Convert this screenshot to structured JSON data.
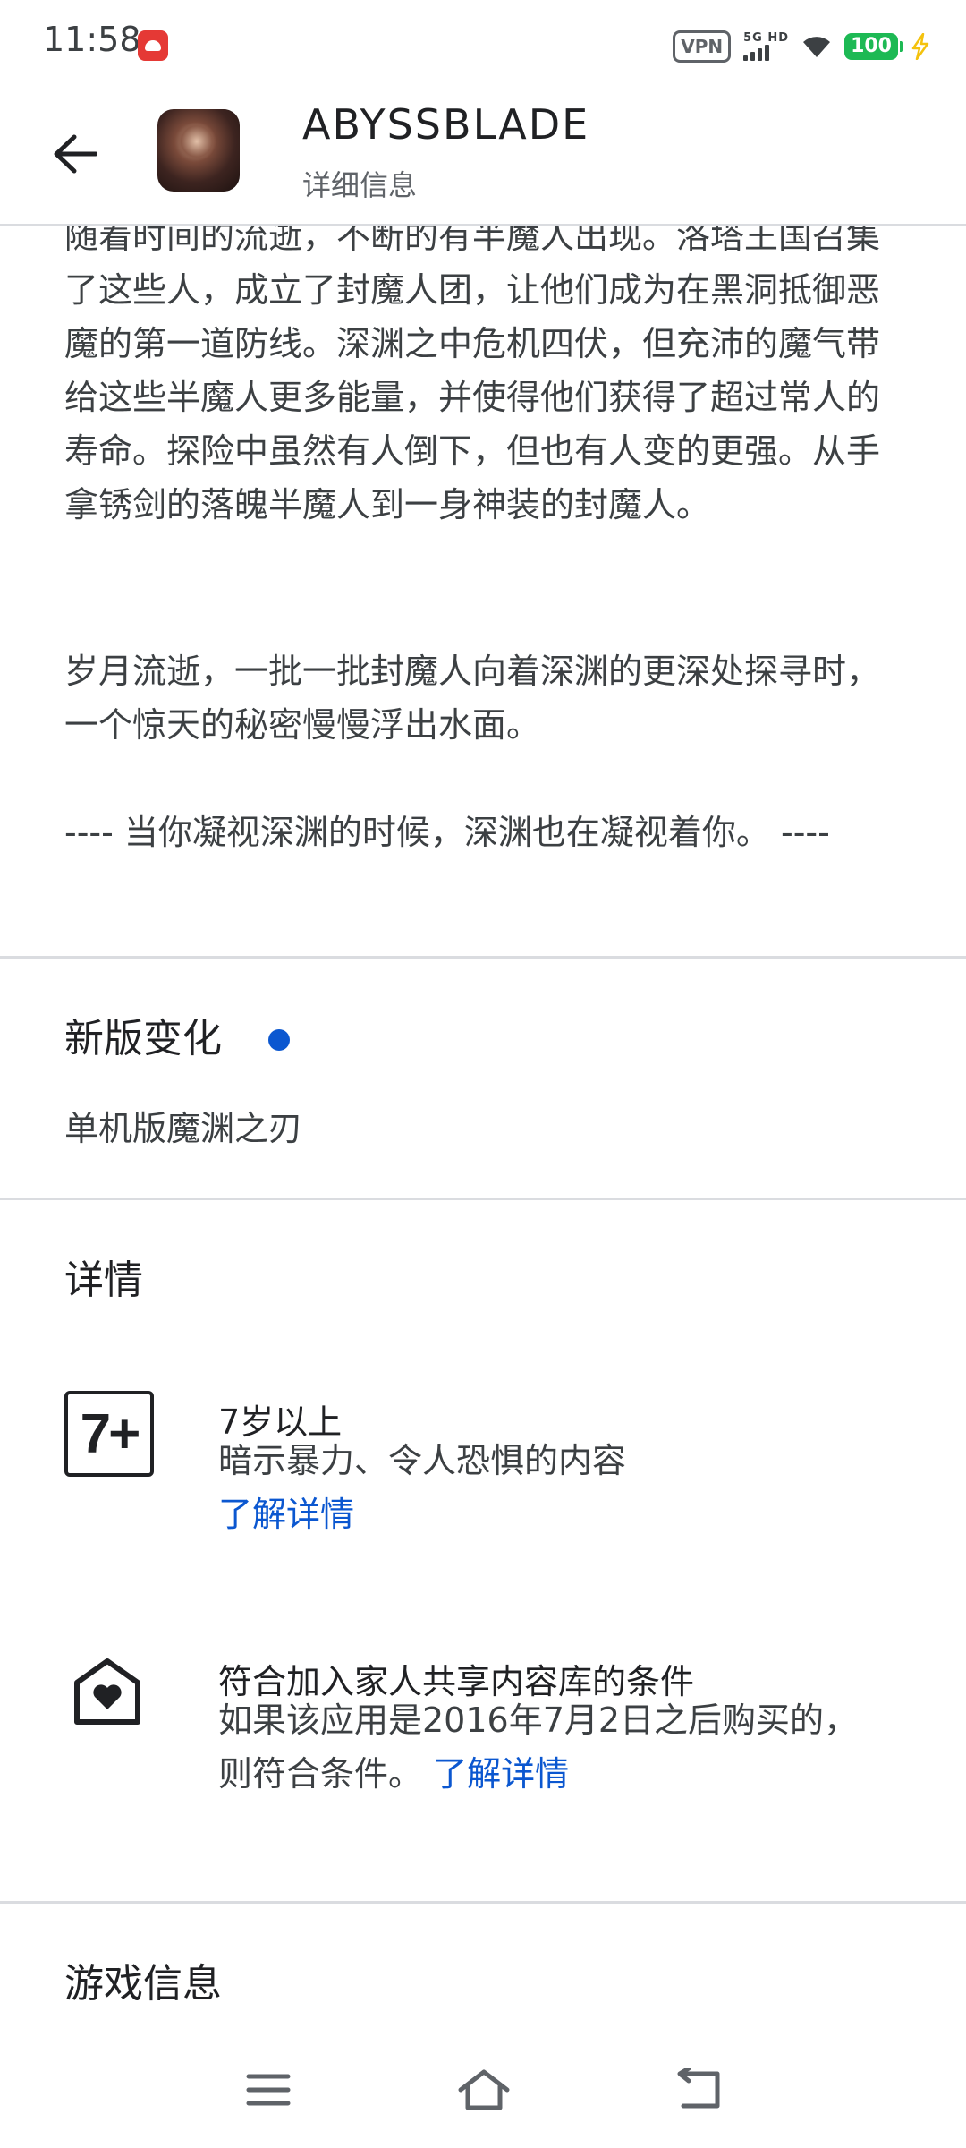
{
  "status_bar": {
    "time": "11:58",
    "vpn": "VPN",
    "network": "5G HD",
    "battery": "100"
  },
  "header": {
    "app_name": "ABYSSBLADE",
    "subtitle": "详细信息"
  },
  "description": {
    "paragraph_1": "随着时间的流逝，不断的有半魔人出现。洛塔王国召集了这些人，成立了封魔人团，让他们成为在黑洞抵御恶魔的第一道防线。深渊之中危机四伏，但充沛的魔气带给这些半魔人更多能量，并使得他们获得了超过常人的寿命。探险中虽然有人倒下，但也有人变的更强。从手拿锈剑的落魄半魔人到一身神装的封魔人。",
    "paragraph_2": "岁月流逝，一批一批封魔人向着深渊的更深处探寻时，一个惊天的秘密慢慢浮出水面。",
    "paragraph_3": "---- 当你凝视深渊的时候，深渊也在凝视着你。 ----"
  },
  "whats_new": {
    "title": "新版变化",
    "text": "单机版魔渊之刃"
  },
  "details": {
    "title": "详情",
    "rating": {
      "icon_text": "7+",
      "title": "7岁以上",
      "text": "暗示暴力、令人恐惧的内容",
      "link": "了解详情"
    },
    "family": {
      "title": "符合加入家人共享内容库的条件",
      "text": "如果该应用是2016年7月2日之后购买的，则符合条件。",
      "link": "了解详情"
    }
  },
  "game_info": {
    "title": "游戏信息"
  },
  "colors": {
    "accent": "#0b57d0",
    "battery": "#1db954",
    "divider": "#dadce0"
  }
}
